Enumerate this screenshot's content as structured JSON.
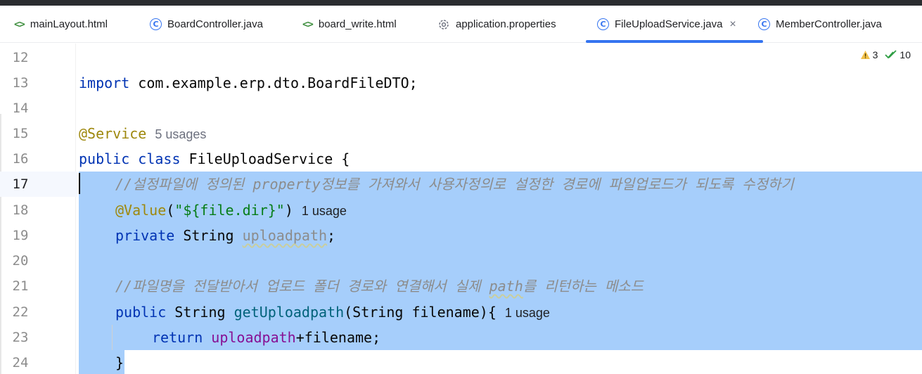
{
  "tabs": [
    {
      "label": "mainLayout.html",
      "icon": "html-file-icon"
    },
    {
      "label": "BoardController.java",
      "icon": "java-class-icon"
    },
    {
      "label": "board_write.html",
      "icon": "html-file-icon"
    },
    {
      "label": "application.properties",
      "icon": "gear-icon"
    },
    {
      "label": "FileUploadService.java",
      "icon": "java-class-icon",
      "active": true
    },
    {
      "label": "MemberController.java",
      "icon": "java-class-icon"
    }
  ],
  "tab_close_glyph": "×",
  "inspections": {
    "warnings": "3",
    "weak_warnings": "10"
  },
  "line_numbers": [
    "12",
    "13",
    "14",
    "15",
    "16",
    "17",
    "18",
    "19",
    "20",
    "21",
    "22",
    "23",
    "24"
  ],
  "code": {
    "l13_kw": "import",
    "l13_rest": " com.example.erp.dto.BoardFileDTO;",
    "l15_ann": "@Service",
    "l15_hint": "5 usages",
    "l16_kw": "public class",
    "l16_rest": " FileUploadService {",
    "l17_comment": "//설정파일에 정의된 property정보를 가져와서 사용자정의로 설정한 경로에 파일업로드가 되도록 수정하기",
    "l18_ann": "@Value",
    "l18_open": "(",
    "l18_str": "\"${file.dir}\"",
    "l18_close": ")",
    "l18_hint": "1 usage",
    "l19_kw": "private",
    "l19_type": " String ",
    "l19_field": "uploadpath",
    "l19_end": ";",
    "l21_comment_a": "//파일명을 전달받아서 업로드 폴더 경로와 연결해서 실제 ",
    "l21_comment_b": "path",
    "l21_comment_c": "를 리턴하는 메소드",
    "l22_kw": "public",
    "l22_type": " String ",
    "l22_method": "getUploadpath",
    "l22_rest": "(String filename){",
    "l22_hint": "1 usage",
    "l23_kw": "return",
    "l23_field": "uploadpath",
    "l23_rest": "+filename;",
    "l24": "}"
  }
}
